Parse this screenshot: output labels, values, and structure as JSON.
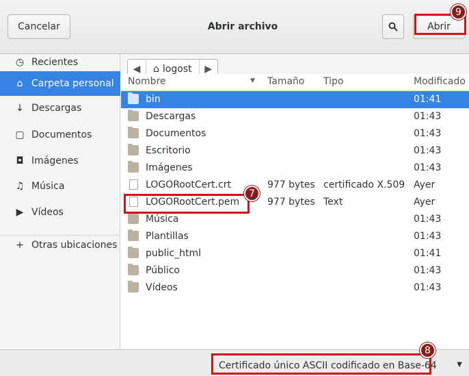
{
  "header": {
    "cancel_label": "Cancelar",
    "title": "Abrir archivo",
    "search_icon": "🔍",
    "open_label": "Abrir"
  },
  "sidebar": {
    "items": [
      {
        "icon": "◷",
        "label": "Recientes"
      },
      {
        "icon": "⌂",
        "label": "Carpeta personal"
      },
      {
        "icon": "↓",
        "label": "Descargas"
      },
      {
        "icon": "▢",
        "label": "Documentos"
      },
      {
        "icon": "◘",
        "label": "Imágenes"
      },
      {
        "icon": "♫",
        "label": "Música"
      },
      {
        "icon": "▶",
        "label": "Vídeos"
      },
      {
        "icon": "+",
        "label": "Otras ubicaciones"
      }
    ]
  },
  "pathbar": {
    "left_arrow": "◀",
    "home_icon": "⌂",
    "crumb": "logost",
    "right_arrow": "▶"
  },
  "columns": {
    "name": "Nombre",
    "sort_icon": "▼",
    "size": "Tamaño",
    "type": "Tipo",
    "modified": "Modificado"
  },
  "files": [
    {
      "name": "bin",
      "size": "",
      "type": "",
      "modified": "01:41"
    },
    {
      "name": "Descargas",
      "size": "",
      "type": "",
      "modified": "01:43"
    },
    {
      "name": "Documentos",
      "size": "",
      "type": "",
      "modified": "01:43"
    },
    {
      "name": "Escritorio",
      "size": "",
      "type": "",
      "modified": "01:43"
    },
    {
      "name": "Imágenes",
      "size": "",
      "type": "",
      "modified": "01:43"
    },
    {
      "name": "LOGORootCert.crt",
      "size": "977 bytes",
      "type": "certificado X.509",
      "modified": "Ayer"
    },
    {
      "name": "LOGORootCert.pem",
      "size": "977 bytes",
      "type": "Text",
      "modified": "Ayer"
    },
    {
      "name": "Música",
      "size": "",
      "type": "",
      "modified": "01:43"
    },
    {
      "name": "Plantillas",
      "size": "",
      "type": "",
      "modified": "01:43"
    },
    {
      "name": "public_html",
      "size": "",
      "type": "",
      "modified": "01:41"
    },
    {
      "name": "Público",
      "size": "",
      "type": "",
      "modified": "01:43"
    },
    {
      "name": "Vídeos",
      "size": "",
      "type": "",
      "modified": "01:43"
    }
  ],
  "footer": {
    "filter_label": "Certificado único ASCII codificado en Base-64",
    "filter_arrow": "▼"
  },
  "annotations": {
    "step_open": "9",
    "step_file": "7",
    "step_filter": "8"
  },
  "colors": {
    "selection": "#3584e4",
    "annotation_red": "#d0121b"
  }
}
